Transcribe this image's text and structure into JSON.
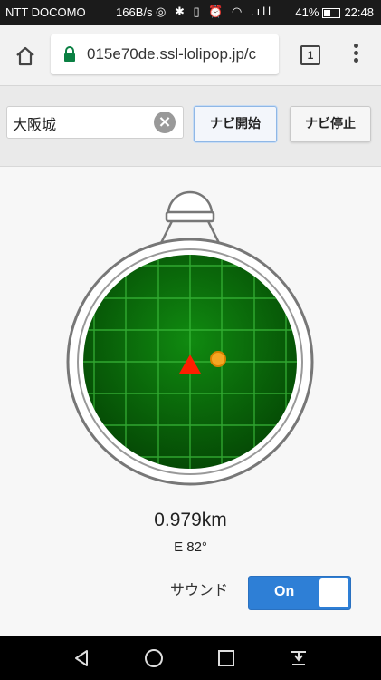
{
  "status": {
    "carrier": "NTT DOCOMO",
    "rate": "166B/s",
    "signal": ".ıll",
    "battery": "41%",
    "time": "22:48"
  },
  "browser": {
    "url": "015e70de.ssl-lolipop.jp/c",
    "tab_count": "1"
  },
  "nav": {
    "destination_value": "大阪城",
    "clear_glyph": "×",
    "start_label": "ナビ開始",
    "stop_label": "ナビ停止"
  },
  "readout": {
    "distance": "0.979km",
    "bearing": "E 82°"
  },
  "sound": {
    "label": "サウンド",
    "toggle_text": "On",
    "enabled": true
  },
  "colors": {
    "radar_green": "#0c7a0c",
    "grid": "#3fc13f",
    "marker": "#ff1e00",
    "target": "#f5a623",
    "toggle": "#2e7fd6"
  }
}
